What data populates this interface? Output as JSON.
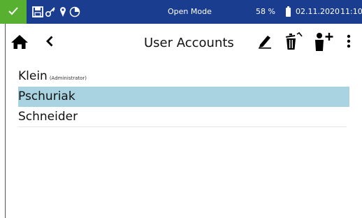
{
  "status_bar": {
    "mode": "Open Mode",
    "battery": "58 %",
    "date": "02.11.2020",
    "time": "11:10",
    "colors": {
      "background": "#1a3d8f",
      "ok_box": "#58b030"
    },
    "icons": [
      "check-icon",
      "save-icon",
      "key-icon",
      "pin-icon",
      "timer-icon",
      "battery-icon"
    ]
  },
  "header": {
    "title": "User Accounts",
    "icons": [
      "home-icon",
      "back-icon",
      "edit-icon",
      "delete-icon",
      "add-user-icon",
      "more-icon"
    ]
  },
  "users": [
    {
      "name": "Klein",
      "role": "(Administrator)",
      "selected": false
    },
    {
      "name": "Pschuriak",
      "role": "",
      "selected": true
    },
    {
      "name": "Schneider",
      "role": "",
      "selected": false
    }
  ],
  "colors": {
    "selection": "#a9d3e1"
  }
}
